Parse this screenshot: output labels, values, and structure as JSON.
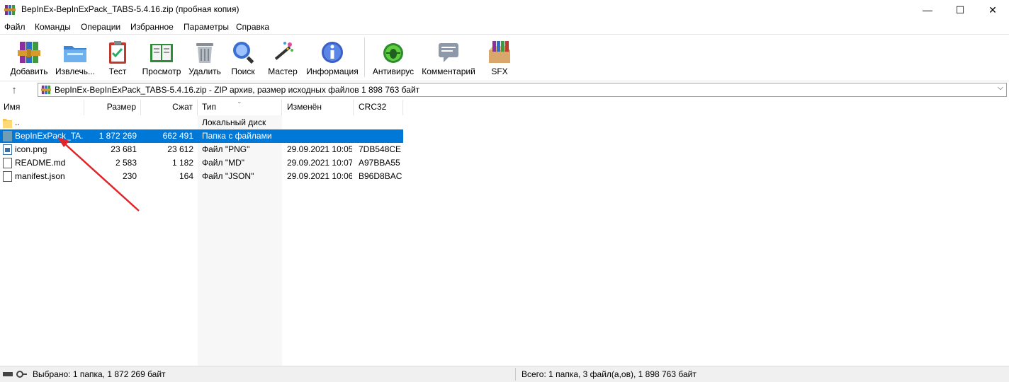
{
  "window": {
    "title": "BepInEx-BepInExPack_TABS-5.4.16.zip (пробная копия)",
    "minimize_glyph": "—",
    "maximize_glyph": "☐",
    "close_glyph": "✕"
  },
  "menu": [
    "Файл",
    "Команды",
    "Операции",
    "Избранное",
    "Параметры",
    "Справка"
  ],
  "toolbar": {
    "buttons": [
      {
        "label": "Добавить",
        "icon": "add-archive-icon"
      },
      {
        "label": "Извлечь...",
        "icon": "extract-folder-icon"
      },
      {
        "label": "Тест",
        "icon": "test-clipboard-icon"
      },
      {
        "label": "Просмотр",
        "icon": "view-book-icon"
      },
      {
        "label": "Удалить",
        "icon": "trash-icon"
      },
      {
        "label": "Поиск",
        "icon": "magnifier-icon"
      },
      {
        "label": "Мастер",
        "icon": "wizard-wand-icon"
      },
      {
        "label": "Информация",
        "icon": "info-icon"
      },
      {
        "label": "Антивирус",
        "icon": "antivirus-bug-icon"
      },
      {
        "label": "Комментарий",
        "icon": "comment-icon"
      },
      {
        "label": "SFX",
        "icon": "sfx-box-icon"
      }
    ]
  },
  "address": {
    "up_glyph": "↑",
    "text": "BepInEx-BepInExPack_TABS-5.4.16.zip - ZIP архив, размер исходных файлов 1 898 763 байт",
    "dropdown_glyph": "⌵"
  },
  "columns": {
    "name": "Имя",
    "size": "Размер",
    "packed": "Сжат",
    "type": "Тип",
    "modified": "Изменён",
    "crc": "CRC32",
    "sort_glyph": "⌄"
  },
  "files": [
    {
      "name": "..",
      "size": "",
      "packed": "",
      "type": "Локальный диск",
      "modified": "",
      "crc": "",
      "icon": "folder-icon",
      "selected": false
    },
    {
      "name": "BepInExPack_TA...",
      "size": "1 872 269",
      "packed": "662 491",
      "type": "Папка с файлами",
      "modified": "",
      "crc": "",
      "icon": "folder-icon",
      "selected": true
    },
    {
      "name": "icon.png",
      "size": "23 681",
      "packed": "23 612",
      "type": "Файл \"PNG\"",
      "modified": "29.09.2021 10:05",
      "crc": "7DB548CE",
      "icon": "image-file-icon",
      "selected": false
    },
    {
      "name": "README.md",
      "size": "2 583",
      "packed": "1 182",
      "type": "Файл \"MD\"",
      "modified": "29.09.2021 10:07",
      "crc": "A97BBA55",
      "icon": "document-file-icon",
      "selected": false
    },
    {
      "name": "manifest.json",
      "size": "230",
      "packed": "164",
      "type": "Файл \"JSON\"",
      "modified": "29.09.2021 10:06",
      "crc": "B96D8BAC",
      "icon": "document-file-icon",
      "selected": false
    }
  ],
  "status": {
    "left": "Выбрано: 1 папка, 1 872 269 байт",
    "right": "Всего: 1 папка, 3 файл(а,ов), 1 898 763 байт"
  },
  "colors": {
    "selection": "#0078d7",
    "annotation_arrow": "#e0242a"
  }
}
